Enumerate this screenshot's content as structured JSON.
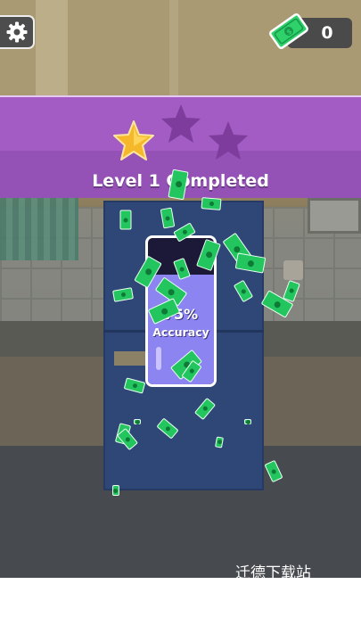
{
  "hud": {
    "settings_icon": "gear-icon",
    "cash_icon": "cash-bill-icon",
    "cash_count": "0"
  },
  "banner": {
    "title": "Level 1 Completed",
    "stars_earned": 1,
    "stars_total": 3,
    "color": "#a25cc4"
  },
  "meter": {
    "percent_label": "75%",
    "label": "Accuracy",
    "fill_fraction": 0.75,
    "fill_color": "#8c84f0"
  },
  "effects": {
    "icon": "cash-bill-icon",
    "color": "#22c55e"
  },
  "watermark": {
    "text": "迁德下载站"
  }
}
